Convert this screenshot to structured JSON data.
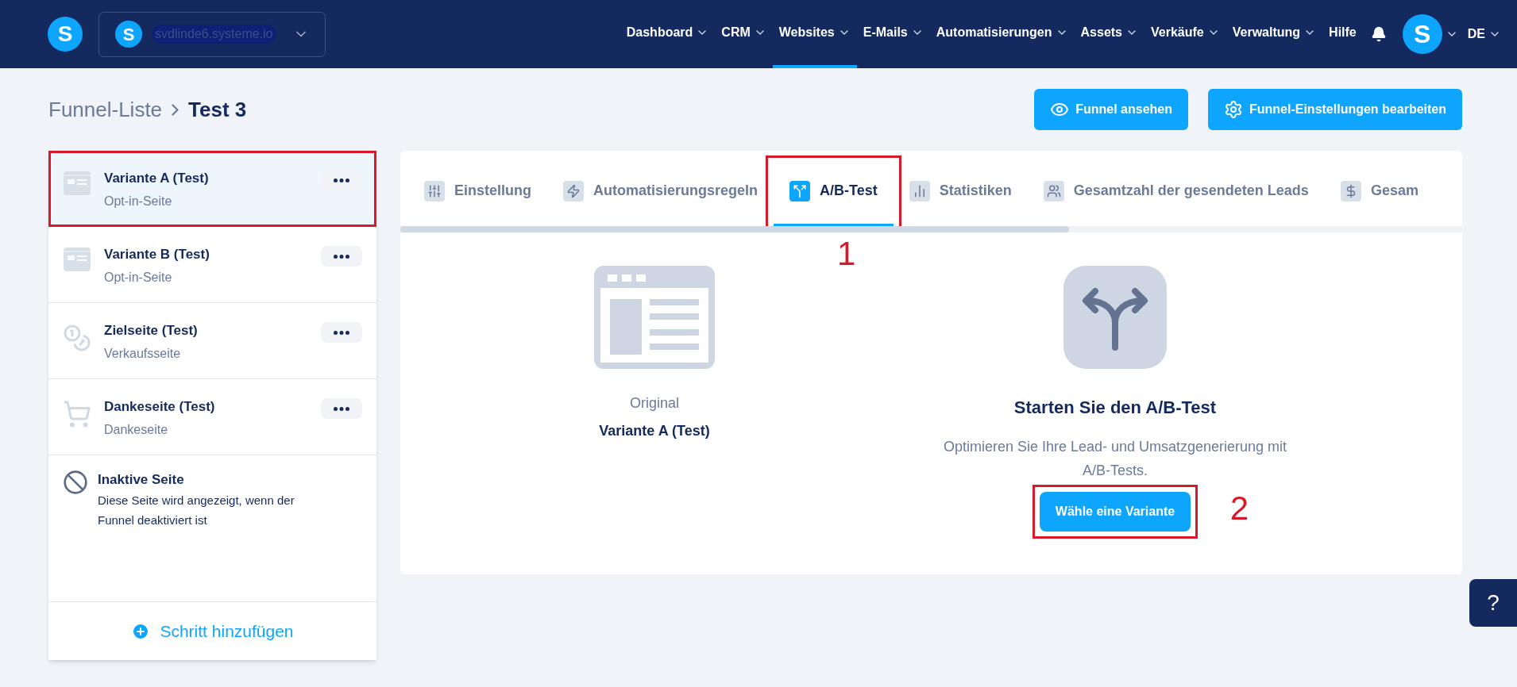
{
  "header": {
    "logo": "S",
    "account": {
      "avatar": "S",
      "domain": "svdlinde6.systeme.io"
    },
    "nav": [
      {
        "label": "Dashboard",
        "dropdown": true,
        "selected": false
      },
      {
        "label": "CRM",
        "dropdown": true,
        "selected": false
      },
      {
        "label": "Websites",
        "dropdown": true,
        "selected": true
      },
      {
        "label": "E-Mails",
        "dropdown": true,
        "selected": false
      },
      {
        "label": "Automatisierungen",
        "dropdown": true,
        "selected": false
      },
      {
        "label": "Assets",
        "dropdown": true,
        "selected": false
      },
      {
        "label": "Verkäufe",
        "dropdown": true,
        "selected": false
      },
      {
        "label": "Verwaltung",
        "dropdown": true,
        "selected": false
      },
      {
        "label": "Hilfe",
        "dropdown": false,
        "selected": false
      }
    ],
    "user_avatar": "S",
    "language": "DE"
  },
  "breadcrumb": {
    "parent": "Funnel-Liste",
    "current": "Test 3"
  },
  "actions": [
    {
      "label": "Funnel ansehen",
      "kind": "eye"
    },
    {
      "label": "Funnel-Einstellungen bearbeiten",
      "kind": "gear"
    }
  ],
  "steps": [
    {
      "title": "Variante A (Test)",
      "subtitle": "Opt-in-Seite",
      "kind": "page",
      "selected": true,
      "marked": true
    },
    {
      "title": "Variante B (Test)",
      "subtitle": "Opt-in-Seite",
      "kind": "page",
      "selected": false,
      "marked": false
    },
    {
      "title": "Zielseite (Test)",
      "subtitle": "Verkaufsseite",
      "kind": "sales",
      "selected": false,
      "marked": false
    },
    {
      "title": "Dankeseite (Test)",
      "subtitle": "Dankeseite",
      "kind": "cart",
      "selected": false,
      "marked": false
    }
  ],
  "inactive_page": {
    "title": "Inaktive Seite",
    "description": "Diese Seite wird angezeigt, wenn der Funnel deaktiviert ist"
  },
  "add_step": "Schritt hinzufügen",
  "tabs": [
    {
      "label": "Einstellung",
      "kind": "sliders",
      "selected": false
    },
    {
      "label": "Automatisierungsregeln",
      "kind": "bolt",
      "selected": false
    },
    {
      "label": "A/B-Test",
      "kind": "split",
      "selected": true,
      "callout": "1"
    },
    {
      "label": "Statistiken",
      "kind": "chart",
      "selected": false
    },
    {
      "label": "Gesamtzahl der gesendeten Leads",
      "kind": "users",
      "selected": false
    },
    {
      "label": "Gesam",
      "kind": "dollar",
      "selected": false
    }
  ],
  "ab_test": {
    "original_label": "Original",
    "original_name": "Variante A (Test)",
    "title": "Starten Sie den A/B-Test",
    "description": "Optimieren Sie Ihre Lead- und Umsatzgenerierung mit A/B-Tests.",
    "button": "Wähle eine Variante",
    "button_callout": "2"
  },
  "help": "?"
}
